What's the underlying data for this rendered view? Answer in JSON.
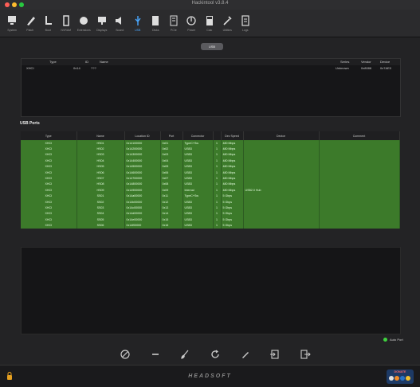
{
  "window": {
    "title": "Hackintool v3.8.4"
  },
  "toolbar": [
    {
      "label": "System",
      "icon": "monitor-icon"
    },
    {
      "label": "Patch",
      "icon": "pencil-icon"
    },
    {
      "label": "Boot",
      "icon": "boot-icon"
    },
    {
      "label": "NVRAM",
      "icon": "chip-icon"
    },
    {
      "label": "Extensions",
      "icon": "puzzle-icon"
    },
    {
      "label": "Displays",
      "icon": "display-icon"
    },
    {
      "label": "Sound",
      "icon": "speaker-icon"
    },
    {
      "label": "USB",
      "icon": "usb-icon",
      "active": true
    },
    {
      "label": "Disks",
      "icon": "disk-icon"
    },
    {
      "label": "PCIe",
      "icon": "pcie-icon"
    },
    {
      "label": "Power",
      "icon": "power-icon"
    },
    {
      "label": "Calc",
      "icon": "calculator-icon"
    },
    {
      "label": "Utilities",
      "icon": "tools-icon"
    },
    {
      "label": "Logs",
      "icon": "document-icon"
    }
  ],
  "segment_label": "USB",
  "controllers": {
    "headers": [
      "Type",
      "ID",
      "Name",
      "Series",
      "Vendor",
      "Device"
    ],
    "rows": [
      [
        "XHCI",
        "0x14",
        "???",
        "Unknown",
        "0x8086",
        "0x7AE0"
      ]
    ]
  },
  "ports_section": {
    "title": "USB Ports"
  },
  "ports": {
    "headers": [
      "Type",
      "Name",
      "Location ID",
      "Port",
      "Connector",
      "",
      "Dev Speed",
      "Device",
      "Comment"
    ],
    "rows": [
      [
        "XHCI",
        "HS01",
        "0x14100000",
        "0x01",
        "TypeC+Sw",
        "1",
        "480 Mbps",
        "",
        ""
      ],
      [
        "XHCI",
        "HS02",
        "0x14200000",
        "0x02",
        "USB3",
        "1",
        "480 Mbps",
        "",
        ""
      ],
      [
        "XHCI",
        "HS03",
        "0x14300000",
        "0x03",
        "USB3",
        "1",
        "480 Mbps",
        "",
        ""
      ],
      [
        "XHCI",
        "HS04",
        "0x14400000",
        "0x04",
        "USB3",
        "1",
        "480 Mbps",
        "",
        ""
      ],
      [
        "XHCI",
        "HS05",
        "0x14500000",
        "0x05",
        "USB3",
        "1",
        "480 Mbps",
        "",
        ""
      ],
      [
        "XHCI",
        "HS06",
        "0x14600000",
        "0x06",
        "USB3",
        "1",
        "480 Mbps",
        "",
        ""
      ],
      [
        "XHCI",
        "HS07",
        "0x14700000",
        "0x07",
        "USB3",
        "1",
        "480 Mbps",
        "",
        ""
      ],
      [
        "XHCI",
        "HS08",
        "0x14800000",
        "0x08",
        "USB3",
        "1",
        "480 Mbps",
        "",
        ""
      ],
      [
        "XHCI",
        "HS09",
        "0x14900000",
        "0x09",
        "Internal",
        "1",
        "480 Mbps",
        "USB2.0 Hub",
        ""
      ],
      [
        "XHCI",
        "SS01",
        "0x14a00000",
        "0x11",
        "TypeC+Sw",
        "1",
        "5 Gbps",
        "",
        ""
      ],
      [
        "XHCI",
        "SS02",
        "0x14b00000",
        "0x12",
        "USB3",
        "1",
        "5 Gbps",
        "",
        ""
      ],
      [
        "XHCI",
        "SS03",
        "0x14c00000",
        "0x13",
        "USB3",
        "1",
        "5 Gbps",
        "",
        ""
      ],
      [
        "XHCI",
        "SS04",
        "0x14d00000",
        "0x14",
        "USB3",
        "1",
        "5 Gbps",
        "",
        ""
      ],
      [
        "XHCI",
        "SS05",
        "0x14e00000",
        "0x15",
        "USB3",
        "1",
        "5 Gbps",
        "",
        ""
      ],
      [
        "XHCI",
        "SS06",
        "0x14f00000",
        "0x16",
        "USB3",
        "1",
        "5 Gbps",
        "",
        ""
      ]
    ]
  },
  "status": {
    "label": "Auto Port",
    "color": "#3fd23f"
  },
  "bottom_actions": [
    "clear-icon",
    "minus-icon",
    "brush-icon",
    "refresh-icon",
    "edit-icon",
    "import-icon",
    "export-icon"
  ],
  "footer": {
    "brand": "HEADSOFT",
    "donate": "DONATE"
  },
  "colors": {
    "row_green": "#3c7a2a",
    "accent": "#4aa8ff",
    "background": "#232325"
  }
}
